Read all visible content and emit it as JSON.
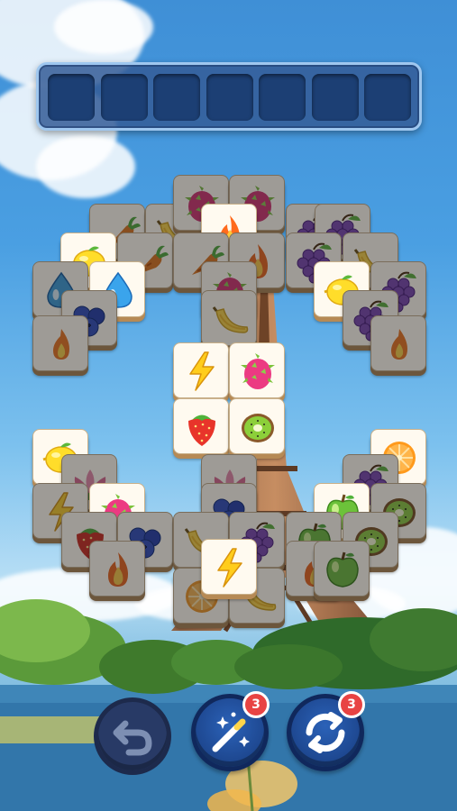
{
  "tray": {
    "slot_count": 7
  },
  "board": {
    "tiles": [
      {
        "icon": "carrot",
        "covered": true
      },
      {
        "icon": "banana",
        "covered": true
      },
      {
        "icon": "grapes",
        "covered": true
      },
      {
        "icon": "grapes",
        "covered": true
      },
      {
        "icon": "dragonfruit",
        "covered": true
      },
      {
        "icon": "dragonfruit",
        "covered": true
      },
      {
        "icon": "fire",
        "covered": false
      },
      {
        "icon": "lemon",
        "covered": false
      },
      {
        "icon": "carrot",
        "covered": true
      },
      {
        "icon": "carrot",
        "covered": true
      },
      {
        "icon": "fire",
        "covered": true
      },
      {
        "icon": "grapes",
        "covered": true
      },
      {
        "icon": "banana",
        "covered": true
      },
      {
        "icon": "dragonfruit",
        "covered": true
      },
      {
        "icon": "water",
        "covered": false
      },
      {
        "icon": "lemon",
        "covered": false
      },
      {
        "icon": "grapes",
        "covered": true
      },
      {
        "icon": "water",
        "covered": true
      },
      {
        "icon": "blueberry",
        "covered": true
      },
      {
        "icon": "banana",
        "covered": true
      },
      {
        "icon": "grapes",
        "covered": true
      },
      {
        "icon": "flame",
        "covered": true
      },
      {
        "icon": "flame",
        "covered": true
      },
      {
        "icon": "lightning",
        "covered": false
      },
      {
        "icon": "dragonfruit",
        "covered": false
      },
      {
        "icon": "strawberry",
        "covered": false
      },
      {
        "icon": "kiwi",
        "covered": false
      },
      {
        "icon": "lemon",
        "covered": false
      },
      {
        "icon": "orange",
        "covered": false
      },
      {
        "icon": "lotus",
        "covered": true
      },
      {
        "icon": "lotus",
        "covered": true
      },
      {
        "icon": "grapes",
        "covered": true
      },
      {
        "icon": "lightning",
        "covered": true
      },
      {
        "icon": "blueberry",
        "covered": true
      },
      {
        "icon": "kiwi",
        "covered": true
      },
      {
        "icon": "dragonfruit",
        "covered": false
      },
      {
        "icon": "apple",
        "covered": false
      },
      {
        "icon": "strawberry",
        "covered": true
      },
      {
        "icon": "blueberry",
        "covered": true
      },
      {
        "icon": "banana",
        "covered": true
      },
      {
        "icon": "grapes",
        "covered": true
      },
      {
        "icon": "apple",
        "covered": true
      },
      {
        "icon": "kiwi",
        "covered": true
      },
      {
        "icon": "fire",
        "covered": true
      },
      {
        "icon": "fire",
        "covered": true
      },
      {
        "icon": "apple",
        "covered": true
      },
      {
        "icon": "orange",
        "covered": true
      },
      {
        "icon": "banana",
        "covered": true
      },
      {
        "icon": "lightning",
        "covered": false
      }
    ]
  },
  "toolbar": {
    "undo": {
      "icon": "undo-arrow-icon"
    },
    "magic": {
      "icon": "magic-wand-icon",
      "count": "3"
    },
    "shuffle": {
      "icon": "shuffle-icon",
      "count": "3"
    }
  },
  "colors": {
    "tile_face": "#fffaf0",
    "tile_edge": "#b68a55",
    "tray": "#1c3f74",
    "badge": "#e84343"
  }
}
